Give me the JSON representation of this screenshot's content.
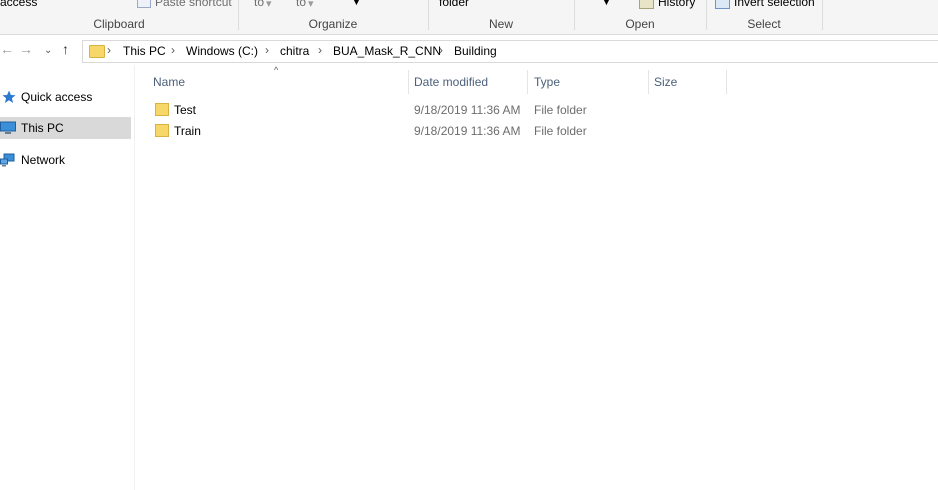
{
  "ribbon": {
    "quick_access_fragment": "access",
    "paste_shortcut": "Paste shortcut",
    "move_to_fragment": "to",
    "copy_to_fragment": "to",
    "new_folder_fragment": "folder",
    "history": "History",
    "invert_selection": "Invert selection",
    "groups": {
      "clipboard": "Clipboard",
      "organize": "Organize",
      "new": "New",
      "open": "Open",
      "select": "Select"
    }
  },
  "breadcrumb": [
    "This PC",
    "Windows (C:)",
    "chitra",
    "BUA_Mask_R_CNN",
    "Building"
  ],
  "sidebar": {
    "items": [
      {
        "label": "Quick access",
        "icon": "star-icon",
        "selected": false
      },
      {
        "label": "This PC",
        "icon": "computer-icon",
        "selected": true
      },
      {
        "label": "Network",
        "icon": "network-icon",
        "selected": false
      }
    ]
  },
  "columns": {
    "name": "Name",
    "date_modified": "Date modified",
    "type": "Type",
    "size": "Size"
  },
  "files": [
    {
      "name": "Test",
      "date_modified": "9/18/2019 11:36 AM",
      "type": "File folder",
      "size": ""
    },
    {
      "name": "Train",
      "date_modified": "9/18/2019 11:36 AM",
      "type": "File folder",
      "size": ""
    }
  ],
  "colors": {
    "folder": "#f7d76a",
    "selected_nav": "#d9d9d9",
    "header_text": "#4c607a"
  }
}
